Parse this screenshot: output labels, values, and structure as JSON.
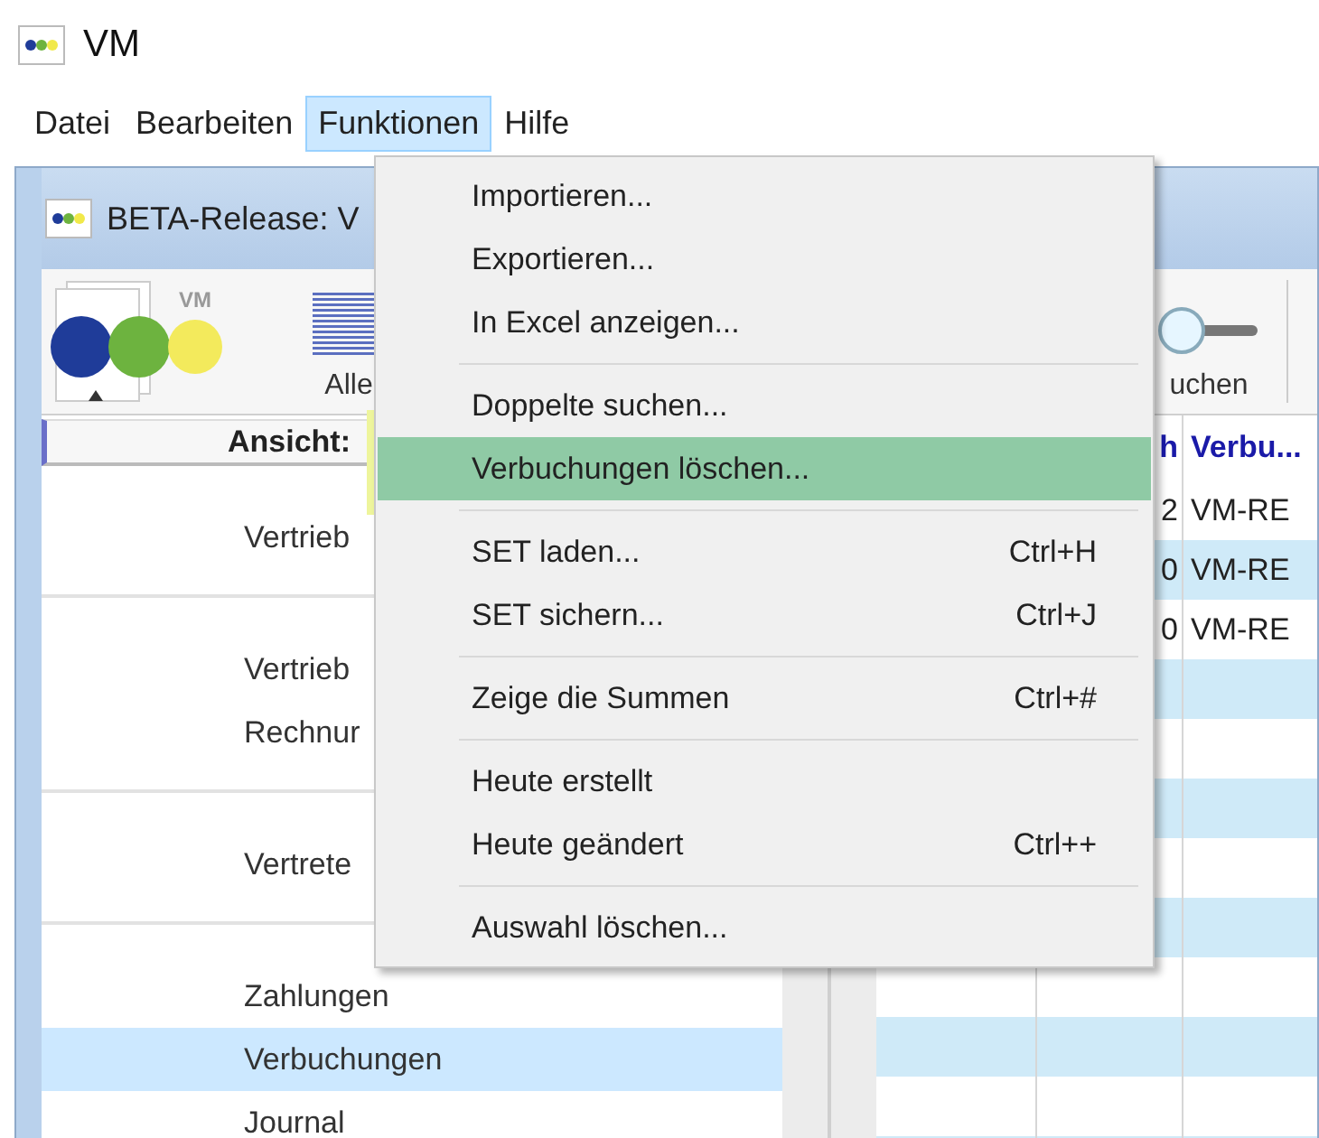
{
  "window": {
    "title": "VM"
  },
  "menubar": [
    {
      "label": "Datei",
      "selected": false
    },
    {
      "label": "Bearbeiten",
      "selected": false
    },
    {
      "label": "Funktionen",
      "selected": true
    },
    {
      "label": "Hilfe",
      "selected": false
    }
  ],
  "child_window": {
    "title": "BETA-Release: V"
  },
  "toolbar": {
    "logo_text": "VM",
    "buttons": [
      {
        "kind": "list",
        "label": "Alle"
      },
      {
        "kind": "search",
        "label": "uchen"
      }
    ]
  },
  "sidebar": {
    "header": "Ansicht:",
    "groups": [
      [
        {
          "label": "Vertrieb",
          "selected": false
        }
      ],
      [
        {
          "label": "Vertrieb",
          "selected": false
        },
        {
          "label": "Rechnur",
          "selected": false
        }
      ],
      [
        {
          "label": "Vertrete",
          "selected": false
        }
      ],
      [
        {
          "label": "Zahlungen",
          "selected": false
        },
        {
          "label": "Verbuchungen",
          "selected": true
        },
        {
          "label": "Journal",
          "selected": false
        }
      ]
    ]
  },
  "grid": {
    "columns": [
      {
        "label": "h"
      },
      {
        "label": "Verbu..."
      }
    ],
    "rows": [
      {
        "cells": [
          "2",
          "VM-RE"
        ]
      },
      {
        "cells": [
          "0",
          "VM-RE"
        ]
      },
      {
        "cells": [
          "0",
          "VM-RE"
        ]
      }
    ]
  },
  "menu": {
    "groups": [
      [
        {
          "label": "Importieren...",
          "selected": false
        },
        {
          "label": "Exportieren...",
          "selected": false
        },
        {
          "label": "In Excel anzeigen...",
          "selected": false
        }
      ],
      [
        {
          "label": "Doppelte suchen...",
          "selected": false
        },
        {
          "label": "Verbuchungen löschen...",
          "selected": true
        }
      ],
      [
        {
          "label": "SET laden...",
          "shortcut": "Ctrl+H",
          "selected": false
        },
        {
          "label": "SET sichern...",
          "shortcut": "Ctrl+J",
          "selected": false
        }
      ],
      [
        {
          "label": "Zeige die Summen",
          "shortcut": "Ctrl+#",
          "selected": false
        }
      ],
      [
        {
          "label": "Heute erstellt",
          "selected": false
        },
        {
          "label": "Heute geändert",
          "shortcut": "Ctrl++",
          "selected": false
        }
      ],
      [
        {
          "label": "Auswahl löschen...",
          "selected": false
        }
      ]
    ]
  }
}
